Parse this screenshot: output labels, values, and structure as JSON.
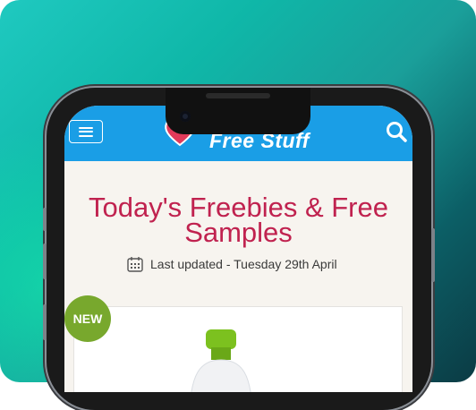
{
  "site": {
    "logo_text": "Free Stuff",
    "brand_color": "#1a9ee6",
    "accent_color": "#c0224f"
  },
  "header": {
    "menu_icon": "hamburger-icon",
    "search_icon": "search-icon"
  },
  "main": {
    "title": "Today's Freebies & Free Samples",
    "updated_label": "Last updated - Tuesday 29th April",
    "updated_icon": "calendar-icon"
  },
  "card": {
    "badge": "NEW",
    "badge_color": "#78a82d"
  }
}
